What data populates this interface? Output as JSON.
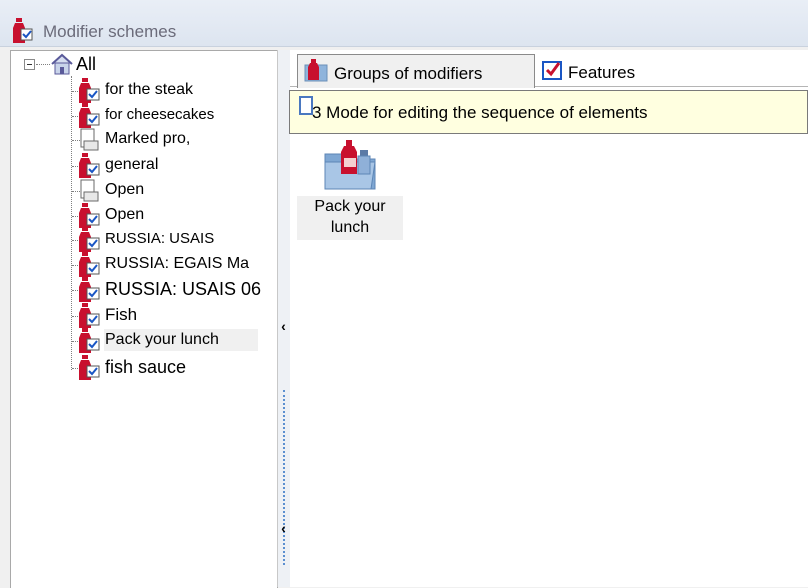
{
  "window": {
    "title": "Modifier schemes"
  },
  "tree": {
    "root": {
      "label": "All"
    },
    "items": [
      {
        "label": "for the steak"
      },
      {
        "label": "for cheesecakes"
      },
      {
        "label": "Marked pro,"
      },
      {
        "label": "general"
      },
      {
        "label": "Open"
      },
      {
        "label": "Open"
      },
      {
        "label": "RUSSIA: USAIS"
      },
      {
        "label": "RUSSIA: EGAIS Ma"
      },
      {
        "label": "RUSSIA: USAIS 06"
      },
      {
        "label": "Fish"
      },
      {
        "label": "Pack your lunch"
      },
      {
        "label": "fish sauce"
      }
    ],
    "selected_index": 10
  },
  "splitter": {
    "top_arrow": "‹",
    "bottom_arrow": "‹"
  },
  "tabs": [
    {
      "label": "Groups of modifiers",
      "active": true
    },
    {
      "label": "Features",
      "active": false
    }
  ],
  "infobar": {
    "text": "3 Mode for editing the sequence of elements"
  },
  "content": {
    "folder_label_line1": "Pack your",
    "folder_label_line2": "lunch"
  },
  "colors": {
    "accent": "#c8102e",
    "selection": "#f0f0f0",
    "infobar_bg": "#ffffe0"
  }
}
